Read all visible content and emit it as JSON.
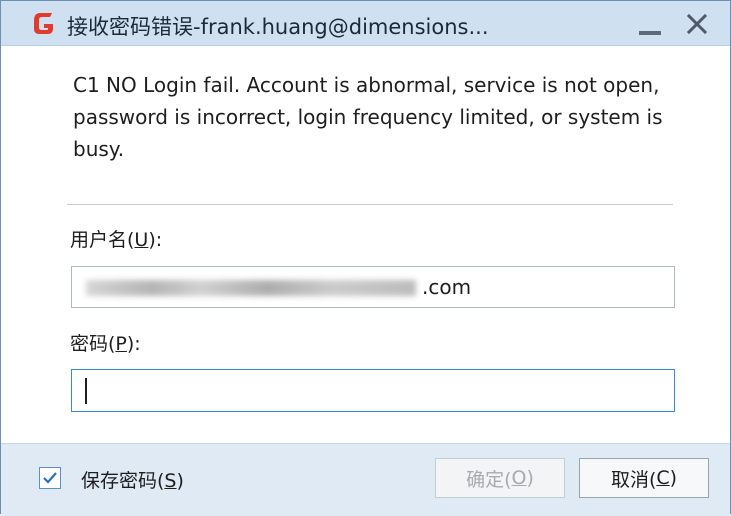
{
  "window": {
    "title": "接收密码错误-frank.huang@dimensions..."
  },
  "message": {
    "text": "C1 NO Login fail. Account is abnormal, service is not open, password is incorrect, login frequency limited, or system is busy."
  },
  "username": {
    "label_prefix": "用户名(",
    "label_hotkey": "U",
    "label_suffix": "):",
    "value_visible_suffix": ".com"
  },
  "password": {
    "label_prefix": "密码(",
    "label_hotkey": "P",
    "label_suffix": "):",
    "value": ""
  },
  "footer": {
    "save_password": {
      "label_prefix": "保存密码(",
      "label_hotkey": "S",
      "label_suffix": ")",
      "checked": true
    },
    "ok_button": {
      "label_prefix": "确定(",
      "label_hotkey": "O",
      "label_suffix": ")",
      "enabled": false
    },
    "cancel_button": {
      "label_prefix": "取消(",
      "label_hotkey": "C",
      "label_suffix": ")"
    }
  },
  "icons": {
    "app": "foxmail-logo-icon",
    "minimize": "minimize-icon",
    "close": "close-icon",
    "check": "checkmark-icon"
  },
  "colors": {
    "brand_red": "#e23b2e",
    "focus_border": "#3c87d4",
    "titlebar_bg": "#cfe0f0",
    "footer_bg": "#dfeaf5"
  }
}
